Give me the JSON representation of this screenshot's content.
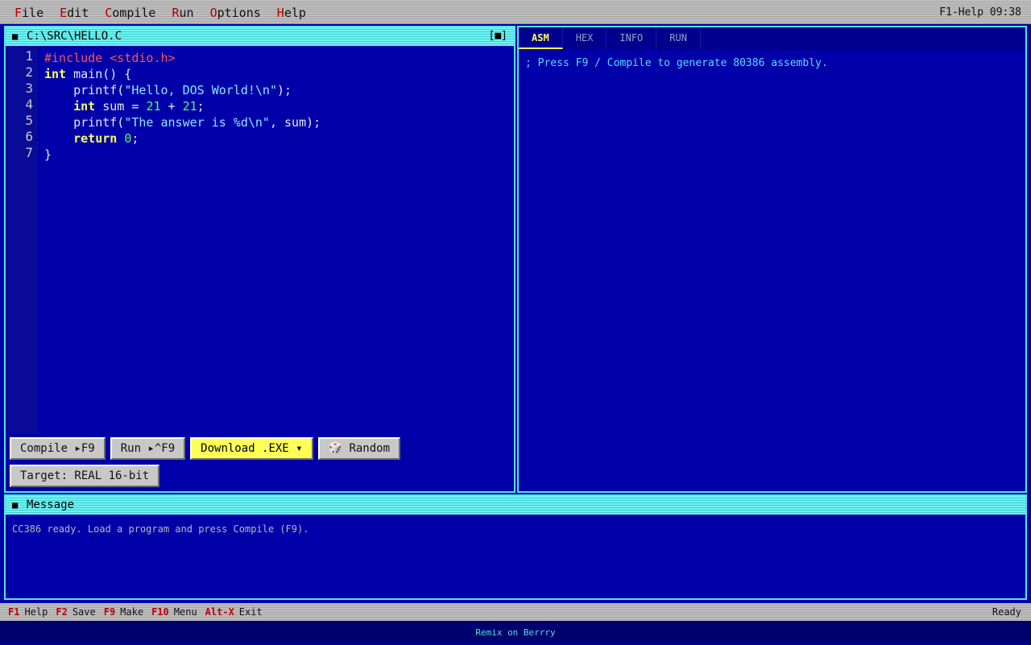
{
  "menubar": {
    "items": [
      {
        "hot": "F",
        "rest": "ile"
      },
      {
        "hot": "E",
        "rest": "dit"
      },
      {
        "hot": "C",
        "rest": "ompile"
      },
      {
        "hot": "R",
        "rest": "un"
      },
      {
        "hot": "O",
        "rest": "ptions"
      },
      {
        "hot": "H",
        "rest": "elp"
      }
    ],
    "right": "F1-Help 09:38"
  },
  "editor": {
    "title": "C:\\SRC\\HELLO.C",
    "close_glyph": "[■]",
    "line_numbers": [
      "1",
      "2",
      "3",
      "4",
      "5",
      "6",
      "7"
    ],
    "buttons": {
      "compile": "Compile ▸F9",
      "run": "Run ▸^F9",
      "download": "Download .EXE ▾",
      "random": "🎲 Random",
      "target": "Target: REAL 16-bit"
    }
  },
  "code_lines": [
    [
      {
        "t": "pp",
        "v": "#include <stdio.h>"
      }
    ],
    [
      {
        "t": "kw",
        "v": "int"
      },
      {
        "t": "",
        "v": " main() {"
      }
    ],
    [
      {
        "t": "",
        "v": "    printf("
      },
      {
        "t": "str",
        "v": "\"Hello, DOS World!\\n\""
      },
      {
        "t": "",
        "v": ");"
      }
    ],
    [
      {
        "t": "",
        "v": "    "
      },
      {
        "t": "kw",
        "v": "int"
      },
      {
        "t": "",
        "v": " sum = "
      },
      {
        "t": "num",
        "v": "21"
      },
      {
        "t": "",
        "v": " + "
      },
      {
        "t": "num",
        "v": "21"
      },
      {
        "t": "",
        "v": ";"
      }
    ],
    [
      {
        "t": "",
        "v": "    printf("
      },
      {
        "t": "str",
        "v": "\"The answer is %d\\n\""
      },
      {
        "t": "",
        "v": ", sum);"
      }
    ],
    [
      {
        "t": "",
        "v": "    "
      },
      {
        "t": "kw",
        "v": "return"
      },
      {
        "t": "",
        "v": " "
      },
      {
        "t": "num",
        "v": "0"
      },
      {
        "t": "",
        "v": ";"
      }
    ],
    [
      {
        "t": "",
        "v": "}"
      }
    ]
  ],
  "output": {
    "tabs": [
      "ASM",
      "HEX",
      "INFO",
      "RUN"
    ],
    "active_tab": "ASM",
    "text": "; Press F9 / Compile to generate 80386 assembly."
  },
  "message": {
    "title": "Message",
    "text": "CC386 ready. Load a program and press Compile (F9)."
  },
  "statusbar": {
    "keys": [
      {
        "key": "F1",
        "label": "Help"
      },
      {
        "key": "F2",
        "label": "Save"
      },
      {
        "key": "F9",
        "label": "Make"
      },
      {
        "key": "F10",
        "label": "Menu"
      },
      {
        "key": "Alt-X",
        "label": "Exit"
      }
    ],
    "state": "Ready"
  },
  "footer": "Remix on Berrry",
  "colors": {
    "background": "#0000a8",
    "frame": "#55e4e4",
    "keyword": "#ffff55",
    "preprocessor": "#ff5555",
    "string": "#8be8ff",
    "number": "#55ff55",
    "hotkey": "#b00000"
  }
}
